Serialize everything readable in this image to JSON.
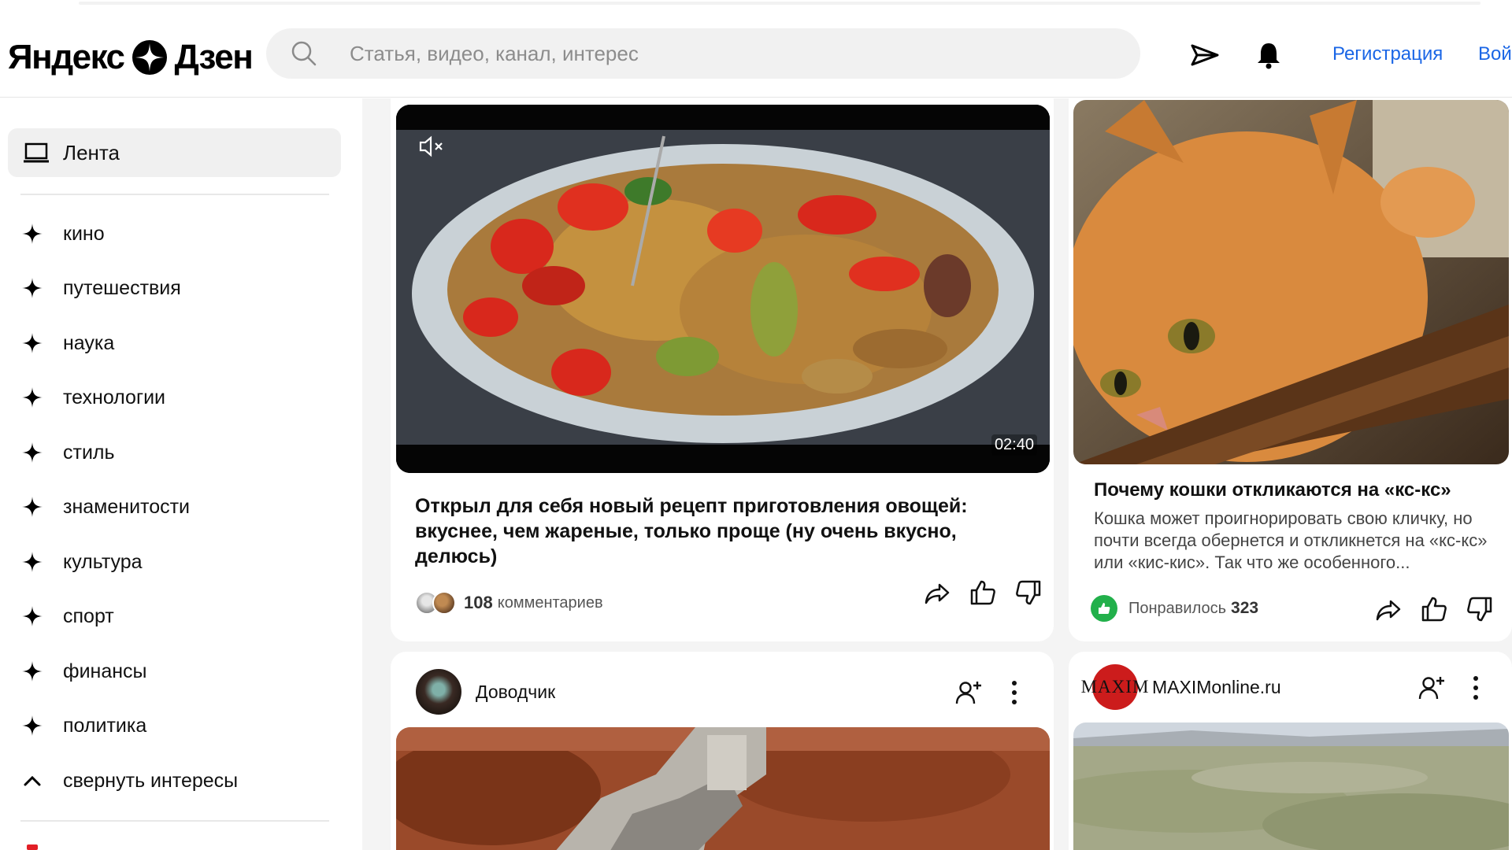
{
  "header": {
    "logo_left": "Яндекс",
    "logo_right": "Дзен",
    "search_placeholder": "Статья, видео, канал, интерес",
    "register": "Регистрация",
    "login": "Войти"
  },
  "sidebar": {
    "feed_label": "Лента",
    "interests": [
      "кино",
      "путешествия",
      "наука",
      "технологии",
      "стиль",
      "знаменитости",
      "культура",
      "спорт",
      "финансы",
      "политика"
    ],
    "collapse_label": "свернуть интересы"
  },
  "cards": [
    {
      "type": "video",
      "duration": "02:40",
      "title": "Открыл для себя новый рецепт приготовления овощей: вкуснее, чем жареные, только проще (ну очень вкусно, делюсь)",
      "comments_count": "108",
      "comments_label": "комментариев"
    },
    {
      "type": "article",
      "title": "Почему кошки откликаются на «кс-кс»",
      "description": "Кошка может проигнорировать свою кличку, но почти всегда обернется и откликнется на «кс-кс» или «кис-кис». Так что же особенного...",
      "likes_label": "Понравилось",
      "likes_count": "323"
    },
    {
      "type": "channel",
      "channel_name": "Доводчик"
    },
    {
      "type": "channel",
      "channel_name": "MAXIMonline.ru",
      "avatar_text": "MAXIM"
    }
  ],
  "colors": {
    "link_blue": "#1a66e6",
    "like_green": "#22b04b",
    "maxim_red": "#cc1c1c"
  }
}
